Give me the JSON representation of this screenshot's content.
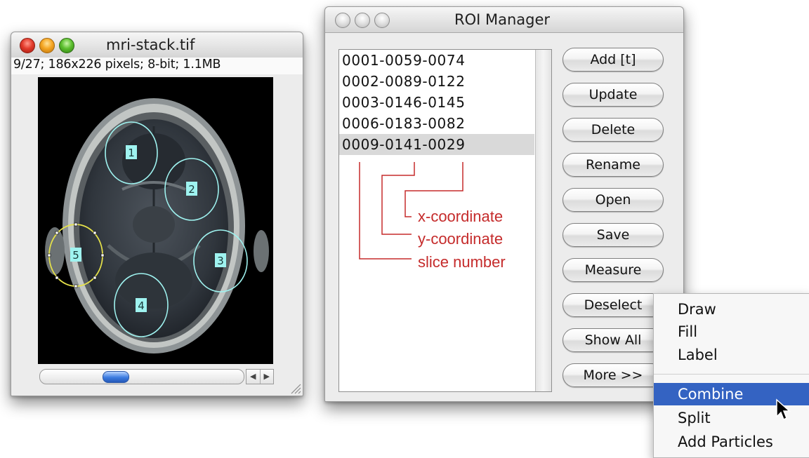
{
  "image_window": {
    "title": "mri-stack.tif",
    "info": "9/27; 186x226 pixels; 8-bit; 1.1MB",
    "slice_position": 0.35,
    "rois": [
      {
        "label": "1"
      },
      {
        "label": "2"
      },
      {
        "label": "3"
      },
      {
        "label": "4"
      },
      {
        "label": "5"
      }
    ]
  },
  "roi_manager": {
    "title": "ROI Manager",
    "list": [
      "0001-0059-0074",
      "0002-0089-0122",
      "0003-0146-0145",
      "0006-0183-0082",
      "0009-0141-0029"
    ],
    "selected_index": 4,
    "buttons": {
      "add": "Add [t]",
      "update": "Update",
      "delete": "Delete",
      "rename": "Rename",
      "open": "Open",
      "save": "Save",
      "measure": "Measure",
      "deselect": "Deselect",
      "show_all": "Show All",
      "more": "More >>"
    },
    "annotations": {
      "x": "x-coordinate",
      "y": "y-coordinate",
      "slice": "slice number"
    }
  },
  "more_menu": {
    "items": [
      "Draw",
      "Fill",
      "Label",
      "Combine",
      "Split",
      "Add Particles"
    ],
    "highlighted": "Combine"
  },
  "colors": {
    "roi_outline": "#9ff3f0",
    "roi_selected": "#e6e24a",
    "annotation": "#c52b2b",
    "menu_highlight": "#3463c2"
  }
}
